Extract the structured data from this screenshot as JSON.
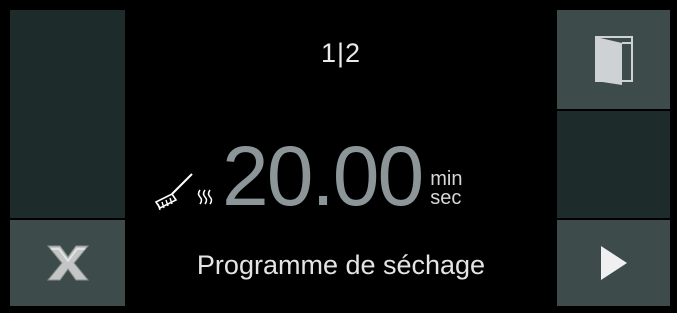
{
  "header": {
    "page_indicator": "1|2"
  },
  "timer": {
    "value": "20.00",
    "unit_top": "min",
    "unit_bottom": "sec"
  },
  "program": {
    "label": "Programme de séchage"
  },
  "icons": {
    "door": "door-icon",
    "drying": "drying-brush-icon",
    "cancel": "close-icon",
    "next": "play-arrow-icon"
  },
  "colors": {
    "button_bg": "#3d4b4b",
    "panel_bg": "#1d2b2b",
    "timer": "#8c9698",
    "text": "#e6e6e6"
  }
}
